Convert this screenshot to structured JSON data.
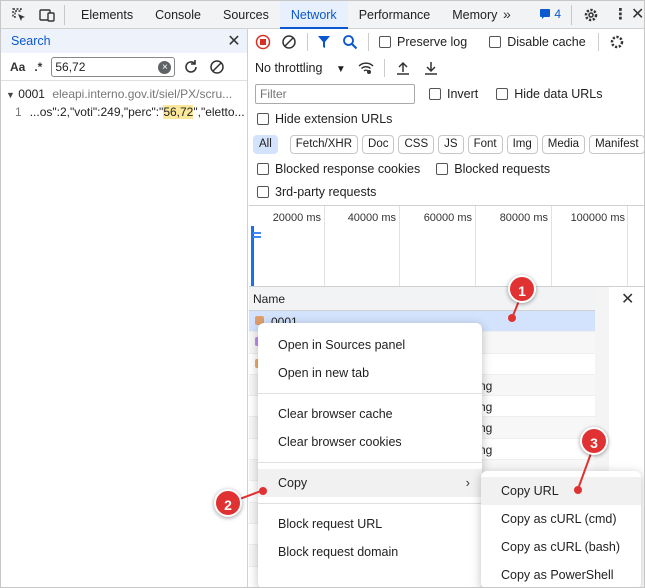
{
  "tabs": [
    "Elements",
    "Console",
    "Sources",
    "Network",
    "Performance",
    "Memory"
  ],
  "active_tab": "Network",
  "issues_count": "4",
  "search": {
    "header": "Search",
    "case_label": "Aa",
    "regex_label": ".*",
    "query": "56,72",
    "result_file_name": "0001",
    "result_file_url": "eleapi.interno.gov.it/siel/PX/scru...",
    "result_line_no": "1",
    "result_before": "...os\":2,\"voti\":249,\"perc\":\"",
    "result_match": "56,72",
    "result_after": "\",\"eletto..."
  },
  "network": {
    "preserve_log": "Preserve log",
    "disable_cache": "Disable cache",
    "throttling": "No throttling",
    "filter_placeholder": "Filter",
    "invert": "Invert",
    "hide_data_urls": "Hide data URLs",
    "hide_extension_urls": "Hide extension URLs",
    "chips": [
      "All",
      "Fetch/XHR",
      "Doc",
      "CSS",
      "JS",
      "Font",
      "Img",
      "Media",
      "Manifest",
      "W"
    ],
    "blocked_cookies": "Blocked response cookies",
    "blocked_requests": "Blocked requests",
    "third_party": "3rd-party requests",
    "timeline_labels": [
      "20000 ms",
      "40000 ms",
      "60000 ms",
      "80000 ms",
      "100000 ms"
    ],
    "column_name": "Name",
    "first_row": "0001",
    "row_tails": [
      "ng",
      "ng",
      "ng",
      "ng"
    ]
  },
  "context_menu": {
    "items": [
      "Open in Sources panel",
      "Open in new tab",
      "Clear browser cache",
      "Clear browser cookies",
      "Copy",
      "Block request URL",
      "Block request domain"
    ]
  },
  "copy_submenu": {
    "items": [
      "Copy URL",
      "Copy as cURL (cmd)",
      "Copy as cURL (bash)",
      "Copy as PowerShell"
    ]
  },
  "callouts": [
    "1",
    "2",
    "3"
  ],
  "colors": {
    "accent": "#0b57d0",
    "callout": "#e03232",
    "highlight": "#fbe89a"
  }
}
